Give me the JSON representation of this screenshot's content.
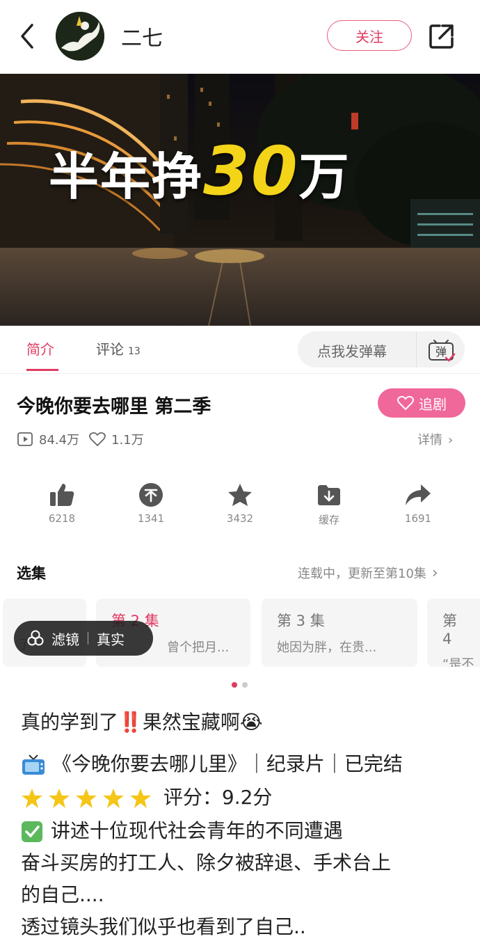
{
  "header": {
    "username": "二七",
    "follow_label": "关注"
  },
  "video": {
    "headline_pre": "半年挣",
    "headline_num": "30",
    "headline_post": "万"
  },
  "tabs": {
    "intro_label": "简介",
    "comments_label": "评论",
    "comments_count": "13",
    "danmu_placeholder": "点我发弹幕",
    "danmu_icon_text": "弹"
  },
  "show": {
    "title": "今晚你要去哪里 第二季",
    "follow_label": "追剧",
    "views": "84.4万",
    "likes": "1.1万",
    "details_label": "详情"
  },
  "actions": [
    {
      "icon": "thumbs-up-icon",
      "label": "6218"
    },
    {
      "icon": "no-coin-icon",
      "label": "1341"
    },
    {
      "icon": "star-icon",
      "label": "3432"
    },
    {
      "icon": "download-icon",
      "label": "缓存"
    },
    {
      "icon": "share-arrow-icon",
      "label": "1691"
    }
  ],
  "episodes": {
    "header": "选集",
    "status": "连载中，更新至第10集",
    "items": [
      {
        "no": "",
        "desc": "了"
      },
      {
        "no": "第 2 集",
        "desc": "曾个把月..."
      },
      {
        "no": "第 3 集",
        "desc": "她因为胖，在贵..."
      },
      {
        "no": "第 4",
        "desc": "“是不"
      }
    ]
  },
  "filter": {
    "label": "滤镜",
    "value": "真实"
  },
  "post": {
    "line1": "真的学到了‼️果然宝藏啊😭",
    "line2": "《今晚你要去哪儿里》｜纪录片｜已完结",
    "line3": "评分：9.2分",
    "line4": "讲述十位现代社会青年的不同遭遇",
    "line5": "奋斗买房的打工人、除夕被辞退、手术台上",
    "line6": "的自己....",
    "line7": "透过镜头我们似乎也看到了自己.."
  },
  "colors": {
    "accent": "#e03a62",
    "follow_show_bg": "#f0679a",
    "headline_highlight": "#f3d418"
  }
}
